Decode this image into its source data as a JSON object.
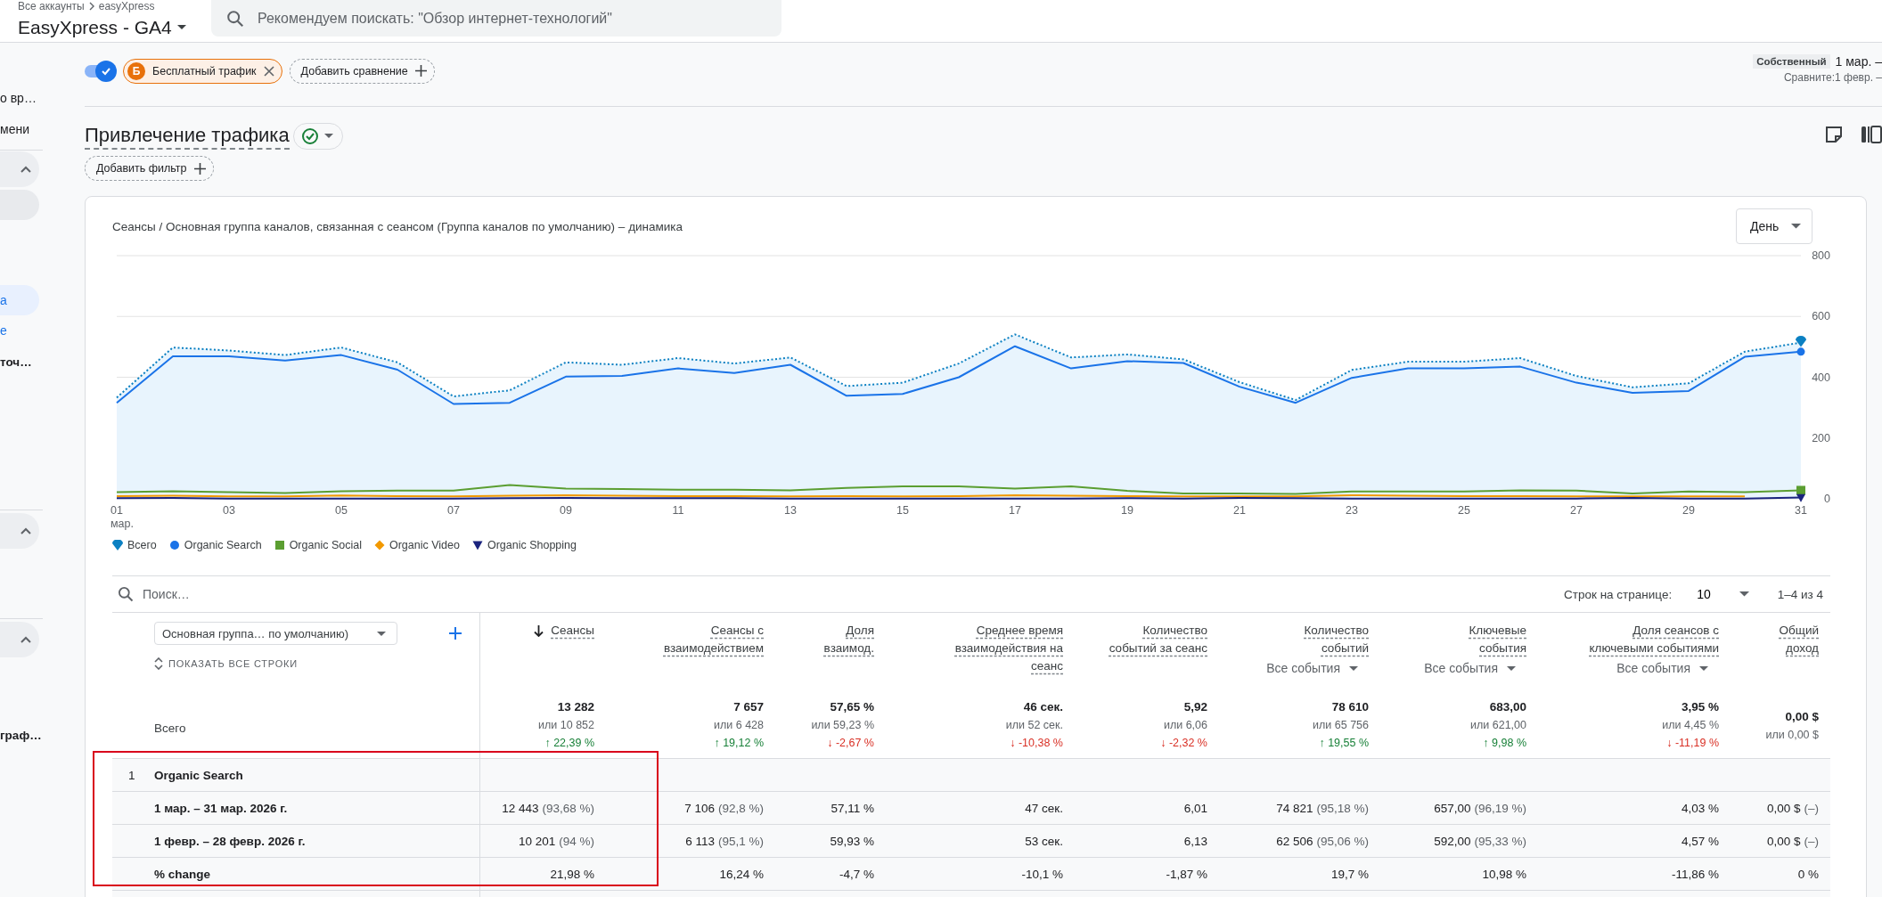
{
  "top_bar": {
    "breadcrumb": [
      "Все аккаунты",
      "easyXpress"
    ],
    "property": "EasyXpress - GA4",
    "search": {
      "placeholder": "Рекомендуем поискать: \"Обзор интернет-технологий\""
    }
  },
  "sidebar": {
    "items": [
      {
        "kind": "item",
        "label": "о вр…",
        "selected": false
      },
      {
        "kind": "item",
        "label": "мени",
        "selected": false
      },
      {
        "kind": "divider"
      },
      {
        "kind": "section",
        "expanded": true
      },
      {
        "kind": "hovered"
      },
      {
        "kind": "item",
        "label": "а",
        "selected": true
      },
      {
        "kind": "subitem",
        "label": "е"
      },
      {
        "kind": "group",
        "label": "точ…"
      },
      {
        "kind": "divider"
      },
      {
        "kind": "section",
        "expanded": true
      },
      {
        "kind": "divider"
      },
      {
        "kind": "section",
        "expanded": true
      },
      {
        "kind": "group",
        "label": "граф…"
      }
    ]
  },
  "comparison": {
    "on": true,
    "chips": [
      {
        "badge": "Б",
        "label": "Бесплатный трафик"
      }
    ],
    "add_label": "Добавить сравнение"
  },
  "date_range": {
    "preset": "Собственный",
    "range": "1 мар. –",
    "compare": "Сравните:1 февр. –"
  },
  "report": {
    "title": "Привлечение трафика",
    "add_filter": "Добавить фильтр"
  },
  "report_card": {
    "title": "Сеансы / Основная группа каналов, связанная с сеансом (Группа каналов по умолчанию) – динамика",
    "granularity": "День",
    "month_label": "мар.",
    "chart_data": {
      "type": "line",
      "grid": true,
      "x": [
        1,
        2,
        3,
        4,
        5,
        6,
        7,
        8,
        9,
        10,
        11,
        12,
        13,
        14,
        15,
        16,
        17,
        18,
        19,
        20,
        21,
        22,
        23,
        24,
        25,
        26,
        27,
        28,
        29,
        30,
        31
      ],
      "xlim": [
        1,
        31
      ],
      "ylim": [
        0,
        800
      ],
      "yticks": [
        0,
        200,
        400,
        600,
        800
      ],
      "xticks": [
        {
          "value": 1,
          "label": "01"
        },
        {
          "value": 3,
          "label": "03"
        },
        {
          "value": 5,
          "label": "05"
        },
        {
          "value": 7,
          "label": "07"
        },
        {
          "value": 9,
          "label": "09"
        },
        {
          "value": 11,
          "label": "11"
        },
        {
          "value": 13,
          "label": "13"
        },
        {
          "value": 15,
          "label": "15"
        },
        {
          "value": 17,
          "label": "17"
        },
        {
          "value": 19,
          "label": "19"
        },
        {
          "value": 21,
          "label": "21"
        },
        {
          "value": 23,
          "label": "23"
        },
        {
          "value": 25,
          "label": "25"
        },
        {
          "value": 27,
          "label": "27"
        },
        {
          "value": 29,
          "label": "29"
        },
        {
          "value": 31,
          "label": "31"
        }
      ],
      "series": [
        {
          "name": "Всего",
          "color": "#0b80c2",
          "type": "area",
          "line_style": "dotted",
          "values": [
            333,
            498,
            488,
            473,
            498,
            449,
            337,
            357,
            449,
            441,
            463,
            445,
            465,
            371,
            382,
            445,
            541,
            465,
            475,
            459,
            384,
            325,
            424,
            451,
            451,
            463,
            404,
            367,
            380,
            484,
            514
          ]
        },
        {
          "name": "Organic Search",
          "color": "#1a73e8",
          "type": "line",
          "line_style": "solid",
          "values": [
            316,
            469,
            469,
            455,
            473,
            425,
            312,
            316,
            402,
            404,
            429,
            414,
            441,
            339,
            345,
            400,
            502,
            429,
            453,
            447,
            369,
            316,
            398,
            429,
            429,
            435,
            382,
            349,
            355,
            467,
            484
          ]
        },
        {
          "name": "Organic Social",
          "color": "#5b9e31",
          "type": "line",
          "line_style": "solid",
          "values": [
            22,
            25,
            22,
            19,
            25,
            27,
            27,
            45,
            34,
            32,
            30,
            30,
            28,
            36,
            41,
            41,
            34,
            41,
            26,
            18,
            18,
            16,
            24,
            24,
            24,
            28,
            27,
            18,
            24,
            22,
            28
          ]
        },
        {
          "name": "Organic Video",
          "color": "#f29900",
          "type": "line",
          "line_style": "solid",
          "values": [
            9,
            10,
            8,
            8,
            11,
            9,
            8,
            10,
            12,
            10,
            9,
            9,
            8,
            9,
            8,
            9,
            12,
            10,
            9,
            8,
            8,
            8,
            12,
            10,
            9,
            9,
            8,
            8,
            8,
            8,
            null
          ]
        },
        {
          "name": "Organic Shopping",
          "color": "#1a237e",
          "type": "line",
          "line_style": "solid",
          "values": [
            2,
            3,
            1,
            1,
            1,
            1,
            1,
            2,
            3,
            2,
            2,
            2,
            1,
            1,
            1,
            1,
            1,
            1,
            2,
            1,
            3,
            2,
            1,
            1,
            1,
            1,
            1,
            3,
            1,
            1,
            4
          ]
        }
      ]
    }
  },
  "table": {
    "search_placeholder": "Поиск…",
    "rows_per_page_label": "Строк на странице:",
    "rows_per_page": "10",
    "range": "1–4 из 4",
    "dimension": "Основная группа… по умолчанию)",
    "show_all": "ПОКАЗАТЬ ВСЕ СТРОКИ",
    "columns": [
      {
        "label": "Сеансы",
        "sorted": true
      },
      {
        "label": "Сеансы с взаимодействием",
        "sorted": false
      },
      {
        "label": "Доля взаимод.",
        "sorted": false
      },
      {
        "label": "Среднее время взаимодействия на сеанс",
        "sorted": false
      },
      {
        "label": "Количество событий за сеанс",
        "sorted": false
      },
      {
        "label": "Количество событий",
        "sorted": false,
        "selector": "Все события"
      },
      {
        "label": "Ключевые события",
        "sorted": false,
        "selector": "Все события"
      },
      {
        "label": "Доля сеансов с ключевыми событиями",
        "sorted": false,
        "selector": "Все события"
      },
      {
        "label": "Общий доход",
        "sorted": false
      }
    ],
    "totals": {
      "label": "Всего",
      "cells": [
        {
          "value": "13 282",
          "compare": "или 10 852",
          "change": "↑ 22,39 %",
          "color": "#188038"
        },
        {
          "value": "7 657",
          "compare": "или 6 428",
          "change": "↑ 19,12 %",
          "color": "#188038"
        },
        {
          "value": "57,65 %",
          "compare": "или 59,23 %",
          "change": "↓ -2,67 %",
          "color": "#d93025"
        },
        {
          "value": "46 сек.",
          "compare": "или 52 сек.",
          "change": "↓ -10,38 %",
          "color": "#d93025"
        },
        {
          "value": "5,92",
          "compare": "или 6,06",
          "change": "↓ -2,32 %",
          "color": "#d93025"
        },
        {
          "value": "78 610",
          "compare": "или 65 756",
          "change": "↑ 19,55 %",
          "color": "#188038"
        },
        {
          "value": "683,00",
          "compare": "или 621,00",
          "change": "↑ 9,98 %",
          "color": "#188038"
        },
        {
          "value": "3,95 %",
          "compare": "или 4,45 %",
          "change": "↓ -11,19 %",
          "color": "#d93025"
        },
        {
          "value": "0,00 $",
          "compare": "или 0,00 $"
        }
      ]
    },
    "rows": [
      {
        "number": "1",
        "label": "Organic Search",
        "cells": []
      },
      {
        "label": "1 мар. – 31 мар. 2026 г.",
        "cells": [
          {
            "value": "12 443",
            "share": "(93,68 %)"
          },
          {
            "value": "7 106",
            "share": "(92,8 %)"
          },
          {
            "value": "57,11 %"
          },
          {
            "value": "47 сек."
          },
          {
            "value": "6,01"
          },
          {
            "value": "74 821",
            "share": "(95,18 %)"
          },
          {
            "value": "657,00",
            "share": "(96,19 %)"
          },
          {
            "value": "4,03 %"
          },
          {
            "value": "0,00 $",
            "share": "(–)"
          }
        ]
      },
      {
        "label": "1 февр. – 28 февр. 2026 г.",
        "cells": [
          {
            "value": "10 201",
            "share": "(94 %)"
          },
          {
            "value": "6 113",
            "share": "(95,1 %)"
          },
          {
            "value": "59,93 %"
          },
          {
            "value": "53 сек."
          },
          {
            "value": "6,13"
          },
          {
            "value": "62 506",
            "share": "(95,06 %)"
          },
          {
            "value": "592,00",
            "share": "(95,33 %)"
          },
          {
            "value": "4,57 %"
          },
          {
            "value": "0,00 $",
            "share": "(–)"
          }
        ]
      },
      {
        "label": "% change",
        "cells": [
          {
            "value": "21,98 %"
          },
          {
            "value": "16,24 %"
          },
          {
            "value": "-4,7 %"
          },
          {
            "value": "-10,1 %"
          },
          {
            "value": "-1,87 %"
          },
          {
            "value": "19,7 %"
          },
          {
            "value": "10,98 %"
          },
          {
            "value": "-11,86 %"
          },
          {
            "value": "0 %"
          }
        ]
      }
    ],
    "highlight_frame": true
  }
}
